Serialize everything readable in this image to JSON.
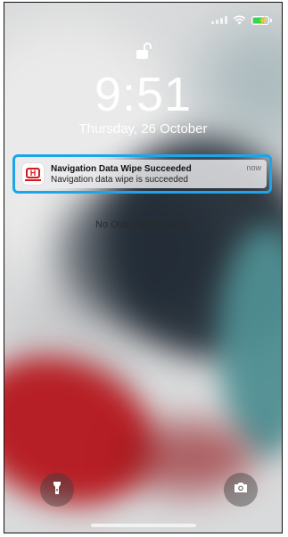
{
  "lock_screen": {
    "time": "9:51",
    "date": "Thursday, 26 October"
  },
  "notification": {
    "app_icon": "honda-icon",
    "title": "Navigation Data Wipe Succeeded",
    "body": "Navigation data wipe is succeeded",
    "time": "now",
    "highlight_color": "#1ea5e9"
  },
  "notification_center": {
    "empty_label": "No Older Notifications"
  },
  "status_bar": {
    "icons": [
      "signal-icon",
      "wifi-icon",
      "battery-charging-icon"
    ],
    "battery_color": "#32d74b"
  },
  "quick_actions": {
    "left": "flashlight-icon",
    "right": "camera-icon"
  }
}
